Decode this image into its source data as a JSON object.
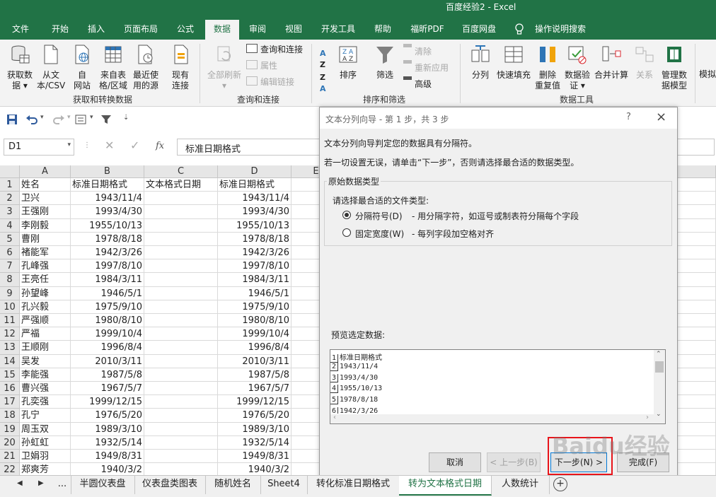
{
  "window": {
    "title": "百度经验2  -  Excel"
  },
  "tabs": [
    {
      "label": "文件"
    },
    {
      "label": "开始"
    },
    {
      "label": "插入"
    },
    {
      "label": "页面布局"
    },
    {
      "label": "公式"
    },
    {
      "label": "数据"
    },
    {
      "label": "审阅"
    },
    {
      "label": "视图"
    },
    {
      "label": "开发工具"
    },
    {
      "label": "帮助"
    },
    {
      "label": "福昕PDF"
    },
    {
      "label": "百度网盘"
    },
    {
      "label": "操作说明搜索"
    }
  ],
  "ribbon": {
    "get_data": {
      "line1": "获取数",
      "line2": "据 ▾"
    },
    "from_text": {
      "line1": "从文",
      "line2": "本/CSV"
    },
    "from_web": {
      "line1": "自",
      "line2": "网站"
    },
    "from_table": {
      "line1": "来自表",
      "line2": "格/区域"
    },
    "recent": {
      "line1": "最近使",
      "line2": "用的源"
    },
    "existing": {
      "line1": "现有",
      "line2": "连接"
    },
    "group1": "获取和转换数据",
    "refresh_all": {
      "line1": "全部刷新",
      "line2": "▾"
    },
    "queries": "查询和连接",
    "properties": "属性",
    "edit_links": "编辑链接",
    "group2": "查询和连接",
    "sort": "排序",
    "filter": "筛选",
    "clear": "清除",
    "reapply": "重新应用",
    "advanced": "高级",
    "group3": "排序和筛选",
    "split": "分列",
    "flash_fill": "快速填充",
    "remove_dup": {
      "line1": "删除",
      "line2": "重复值"
    },
    "validation": {
      "line1": "数据验",
      "line2": "证 ▾"
    },
    "consolidate": "合并计算",
    "relations": "关系",
    "data_model": {
      "line1": "管理数",
      "line2": "据模型"
    },
    "group4": "数据工具",
    "what_if": "模拟"
  },
  "formula_bar": {
    "name_box": "D1",
    "fx": "fx",
    "content": "标准日期格式"
  },
  "columns": [
    "A",
    "B",
    "C",
    "D",
    "E"
  ],
  "rows": [
    {
      "n": "1",
      "a": "姓名",
      "b": "标准日期格式",
      "c": "文本格式日期",
      "d": "标准日期格式"
    },
    {
      "n": "2",
      "a": "卫兴",
      "b": "1943/11/4",
      "c": "",
      "d": "1943/11/4"
    },
    {
      "n": "3",
      "a": "王强刚",
      "b": "1993/4/30",
      "c": "",
      "d": "1993/4/30"
    },
    {
      "n": "4",
      "a": "李刚毅",
      "b": "1955/10/13",
      "c": "",
      "d": "1955/10/13"
    },
    {
      "n": "5",
      "a": "曹刚",
      "b": "1978/8/18",
      "c": "",
      "d": "1978/8/18"
    },
    {
      "n": "6",
      "a": "褚能军",
      "b": "1942/3/26",
      "c": "",
      "d": "1942/3/26"
    },
    {
      "n": "7",
      "a": "孔峰强",
      "b": "1997/8/10",
      "c": "",
      "d": "1997/8/10"
    },
    {
      "n": "8",
      "a": "王亮任",
      "b": "1984/3/11",
      "c": "",
      "d": "1984/3/11"
    },
    {
      "n": "9",
      "a": "孙望峰",
      "b": "1946/5/1",
      "c": "",
      "d": "1946/5/1"
    },
    {
      "n": "10",
      "a": "孔兴毅",
      "b": "1975/9/10",
      "c": "",
      "d": "1975/9/10"
    },
    {
      "n": "11",
      "a": "严强顺",
      "b": "1980/8/10",
      "c": "",
      "d": "1980/8/10"
    },
    {
      "n": "12",
      "a": "严福",
      "b": "1999/10/4",
      "c": "",
      "d": "1999/10/4"
    },
    {
      "n": "13",
      "a": "王顺刚",
      "b": "1996/8/4",
      "c": "",
      "d": "1996/8/4"
    },
    {
      "n": "14",
      "a": "吴发",
      "b": "2010/3/11",
      "c": "",
      "d": "2010/3/11"
    },
    {
      "n": "15",
      "a": "李能强",
      "b": "1987/5/8",
      "c": "",
      "d": "1987/5/8"
    },
    {
      "n": "16",
      "a": "曹兴强",
      "b": "1967/5/7",
      "c": "",
      "d": "1967/5/7"
    },
    {
      "n": "17",
      "a": "孔奕强",
      "b": "1999/12/15",
      "c": "",
      "d": "1999/12/15"
    },
    {
      "n": "18",
      "a": "孔宁",
      "b": "1976/5/20",
      "c": "",
      "d": "1976/5/20"
    },
    {
      "n": "19",
      "a": "周玉双",
      "b": "1989/3/10",
      "c": "",
      "d": "1989/3/10"
    },
    {
      "n": "20",
      "a": "孙虹虹",
      "b": "1932/5/14",
      "c": "",
      "d": "1932/5/14"
    },
    {
      "n": "21",
      "a": "卫娟羽",
      "b": "1949/8/31",
      "c": "",
      "d": "1949/8/31"
    },
    {
      "n": "22",
      "a": "郑爽芳",
      "b": "1940/3/2",
      "c": "",
      "d": "1940/3/2"
    }
  ],
  "dialog": {
    "title": "文本分列向导 - 第 1 步，共 3 步",
    "help": "?",
    "close": "×",
    "line1": "文本分列向导判定您的数据具有分隔符。",
    "line2": "若一切设置无误，请单击“下一步”，否则请选择最合适的数据类型。",
    "group_title": "原始数据类型",
    "prompt": "请选择最合适的文件类型:",
    "opt1_label": "分隔符号(D)",
    "opt1_desc": "- 用分隔字符，如逗号或制表符分隔每个字段",
    "opt2_label": "固定宽度(W)",
    "opt2_desc": "- 每列字段加空格对齐",
    "preview_label": "预览选定数据:",
    "preview_rows": [
      {
        "n": "1",
        "text": "标准日期格式"
      },
      {
        "n": "2",
        "text": "1943/11/4"
      },
      {
        "n": "3",
        "text": "1993/4/30"
      },
      {
        "n": "4",
        "text": "1955/10/13"
      },
      {
        "n": "5",
        "text": "1978/8/18"
      },
      {
        "n": "6",
        "text": "1942/3/26"
      }
    ],
    "cancel": "取消",
    "back": "< 上一步(B)",
    "next": "下一步(N) >",
    "finish": "完成(F)"
  },
  "sheets": [
    {
      "label": "..."
    },
    {
      "label": "半圆仪表盘"
    },
    {
      "label": "仪表盘类图表"
    },
    {
      "label": "随机姓名"
    },
    {
      "label": "Sheet4"
    },
    {
      "label": "转化标准日期格式"
    },
    {
      "label": "转为文本格式日期"
    },
    {
      "label": "人数统计"
    }
  ],
  "watermark": "Baidu经验",
  "colors": {
    "excel_green": "#217346",
    "highlight_red": "#e8141a"
  }
}
